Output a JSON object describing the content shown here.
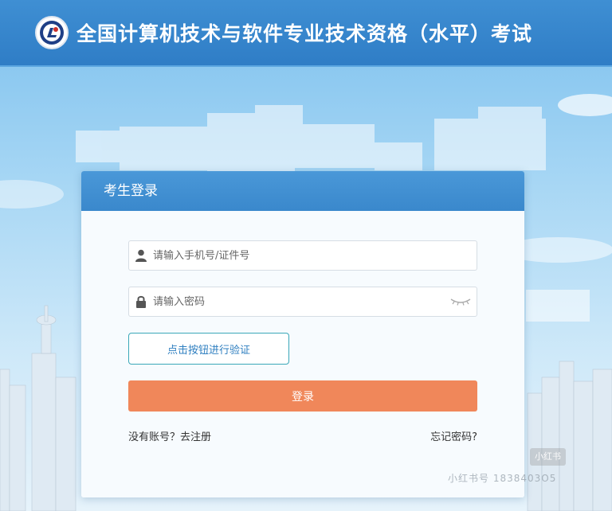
{
  "header": {
    "title": "全国计算机技术与软件专业技术资格（水平）考试",
    "logo_icon": "exam-emblem-icon"
  },
  "login": {
    "title": "考生登录",
    "username": {
      "placeholder": "请输入手机号/证件号",
      "value": "",
      "icon": "user-icon"
    },
    "password": {
      "placeholder": "请输入密码",
      "value": "",
      "icon": "lock-icon",
      "toggle_icon": "eye-closed-icon"
    },
    "verify_button": "点击按钮进行验证",
    "submit_button": "登录",
    "register_link": "没有账号？去注册",
    "forgot_link": "忘记密码?"
  },
  "watermark": {
    "badge": "小红书",
    "text": "小红书号 1838403O5"
  },
  "colors": {
    "header_bg": "#2f7dc6",
    "card_header_bg": "#3a88cc",
    "login_button": "#f0875a",
    "verify_border": "#3aa7b8"
  }
}
